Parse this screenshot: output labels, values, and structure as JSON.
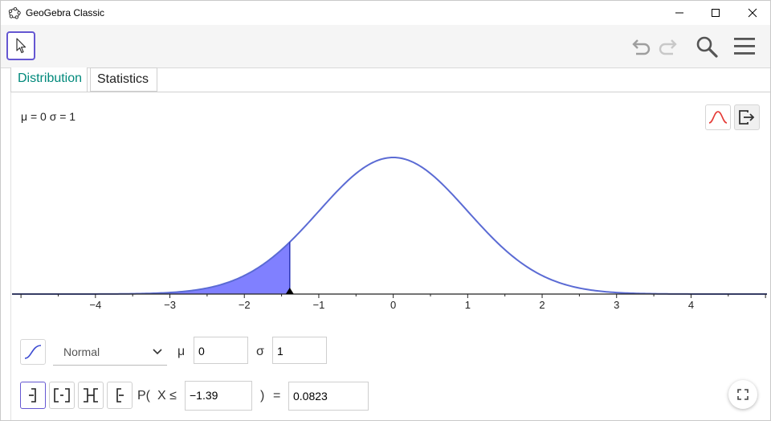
{
  "window": {
    "title": "GeoGebra Classic"
  },
  "tabs": [
    {
      "label": "Distribution"
    },
    {
      "label": "Statistics"
    }
  ],
  "params_text": "μ = 0 σ = 1",
  "distribution": {
    "selected": "Normal",
    "mean_label": "μ",
    "mean": "0",
    "sd_label": "σ",
    "sd": "1"
  },
  "probability": {
    "prefix": "P(",
    "variable": "X ≤",
    "bound": "−1.39",
    "close": ")",
    "equals": "=",
    "result": "0.0823"
  },
  "chart_data": {
    "type": "area",
    "function": "normal pdf",
    "mean": 0,
    "sd": 1,
    "xlim": [
      -5.12,
      5.02
    ],
    "shaded_to": -1.39,
    "x_ticks": [
      -4,
      -3,
      -2,
      -1,
      0,
      1,
      2,
      3,
      4
    ],
    "x_tick_labels": [
      "−4",
      "−3",
      "−2",
      "−1",
      "0",
      "1",
      "2",
      "3",
      "4"
    ],
    "curve_color": "#5b6bd4",
    "fill_color": "#8080ff"
  },
  "colors": {
    "accent": "#6557d2",
    "tab_active": "#00897b"
  }
}
